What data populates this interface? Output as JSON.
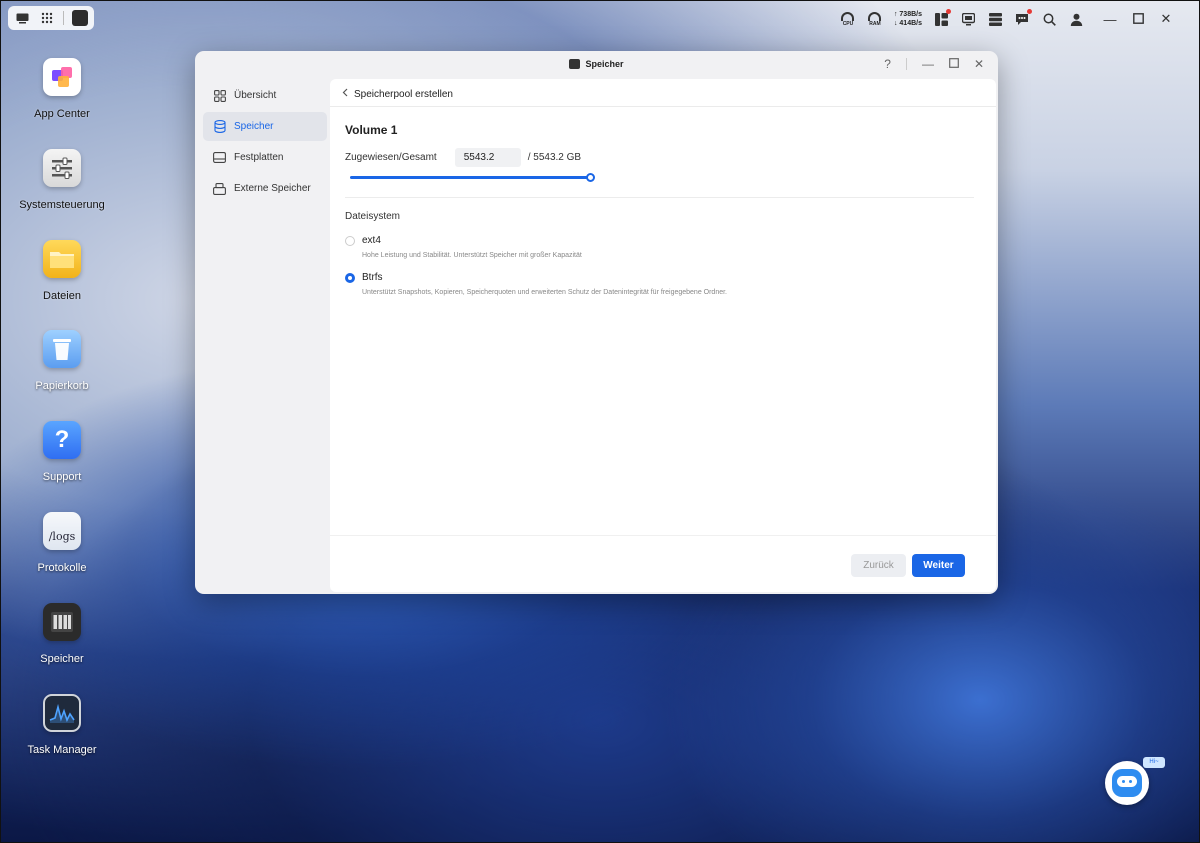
{
  "topbar": {
    "cpu_label": "CPU",
    "ram_label": "RAM",
    "net_up": "↑ 738B/s",
    "net_down": "↓ 414B/s"
  },
  "desktop": {
    "icons": [
      {
        "label": "App Center",
        "icon": "app-center-icon"
      },
      {
        "label": "Systemsteuerung",
        "icon": "settings-sliders-icon"
      },
      {
        "label": "Dateien",
        "icon": "folder-icon"
      },
      {
        "label": "Papierkorb",
        "icon": "trash-icon"
      },
      {
        "label": "Support",
        "icon": "help-icon"
      },
      {
        "label": "Protokolle",
        "icon": "logs-icon",
        "text": "/logs"
      },
      {
        "label": "Speicher",
        "icon": "storage-icon"
      },
      {
        "label": "Task Manager",
        "icon": "task-manager-icon"
      }
    ]
  },
  "window": {
    "title": "Speicher",
    "help": "?",
    "sidebar": [
      {
        "label": "Übersicht",
        "icon": "grid-icon"
      },
      {
        "label": "Speicher",
        "icon": "database-icon",
        "active": true
      },
      {
        "label": "Festplatten",
        "icon": "disk-icon"
      },
      {
        "label": "Externe Speicher",
        "icon": "external-storage-icon"
      }
    ],
    "breadcrumb": "Speicherpool erstellen",
    "volume_title": "Volume 1",
    "allocation": {
      "label": "Zugewiesen/Gesamt",
      "value": "5543.2",
      "total": "/  5543.2 GB",
      "fraction": 1.0
    },
    "filesystem": {
      "title": "Dateisystem",
      "options": [
        {
          "label": "ext4",
          "desc": "Hohe Leistung und Stabilität. Unterstützt Speicher mit großer Kapazität",
          "selected": false
        },
        {
          "label": "Btrfs",
          "desc": "Unterstützt Snapshots, Kopieren, Speicherquoten und erweiterten Schutz der Datenintegrität für freigegebene Ordner.",
          "selected": true
        }
      ]
    },
    "buttons": {
      "back": "Zurück",
      "next": "Weiter"
    }
  },
  "assistant": {
    "bubble": "Hi~"
  },
  "colors": {
    "accent": "#1a66e6"
  }
}
